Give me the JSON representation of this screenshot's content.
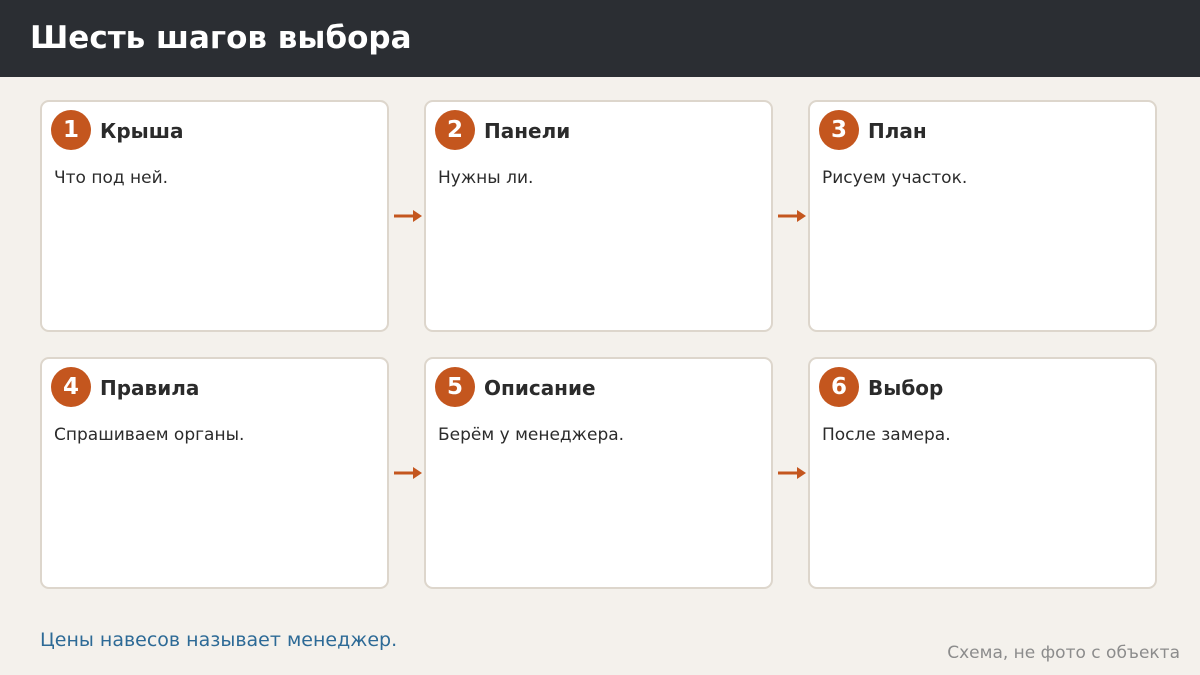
{
  "header": {
    "title": "Шесть шагов выбора"
  },
  "steps": [
    {
      "number": "1",
      "title": "Крыша",
      "description": "Что под ней."
    },
    {
      "number": "2",
      "title": "Панели",
      "description": "Нужны ли."
    },
    {
      "number": "3",
      "title": "План",
      "description": "Рисуем участок."
    },
    {
      "number": "4",
      "title": "Правила",
      "description": "Спрашиваем органы."
    },
    {
      "number": "5",
      "title": "Описание",
      "description": "Берём у менеджера."
    },
    {
      "number": "6",
      "title": "Выбор",
      "description": "После замера."
    }
  ],
  "footer": {
    "note": "Цены навесов называет менеджер."
  },
  "caption": "Схема, не фото с объекта",
  "colors": {
    "header_bg": "#2b2e33",
    "accent": "#c4561e",
    "note": "#2d6a96",
    "background": "#f4f1ec"
  }
}
